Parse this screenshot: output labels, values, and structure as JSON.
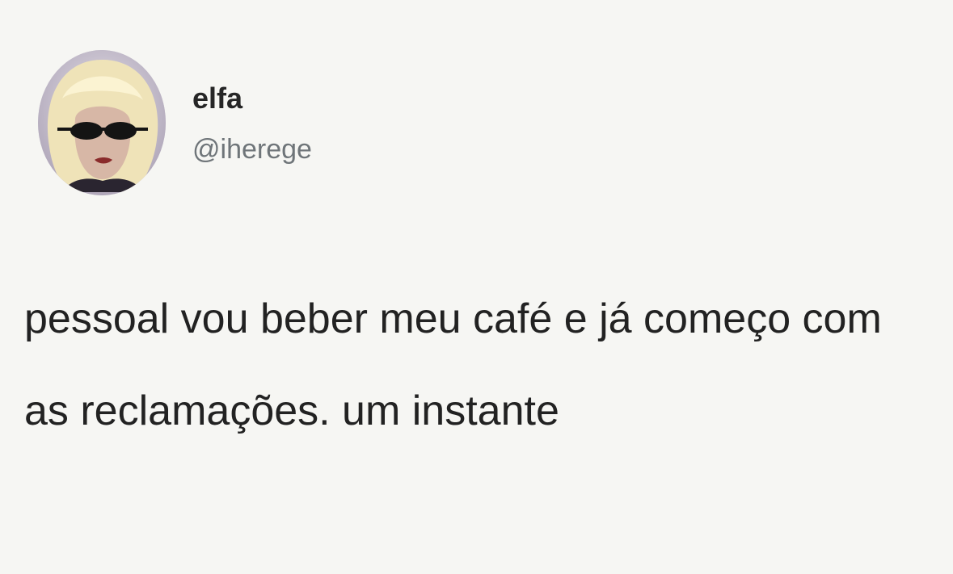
{
  "tweet": {
    "author": {
      "display_name": "elfa",
      "handle": "@iherege",
      "avatar_icon": "profile-photo-blonde-sunglasses"
    },
    "text": "pessoal vou beber meu café e já começo com as reclamações. um instante"
  },
  "colors": {
    "background": "#f6f6f3",
    "text": "#222222",
    "handle": "#6f7579"
  }
}
